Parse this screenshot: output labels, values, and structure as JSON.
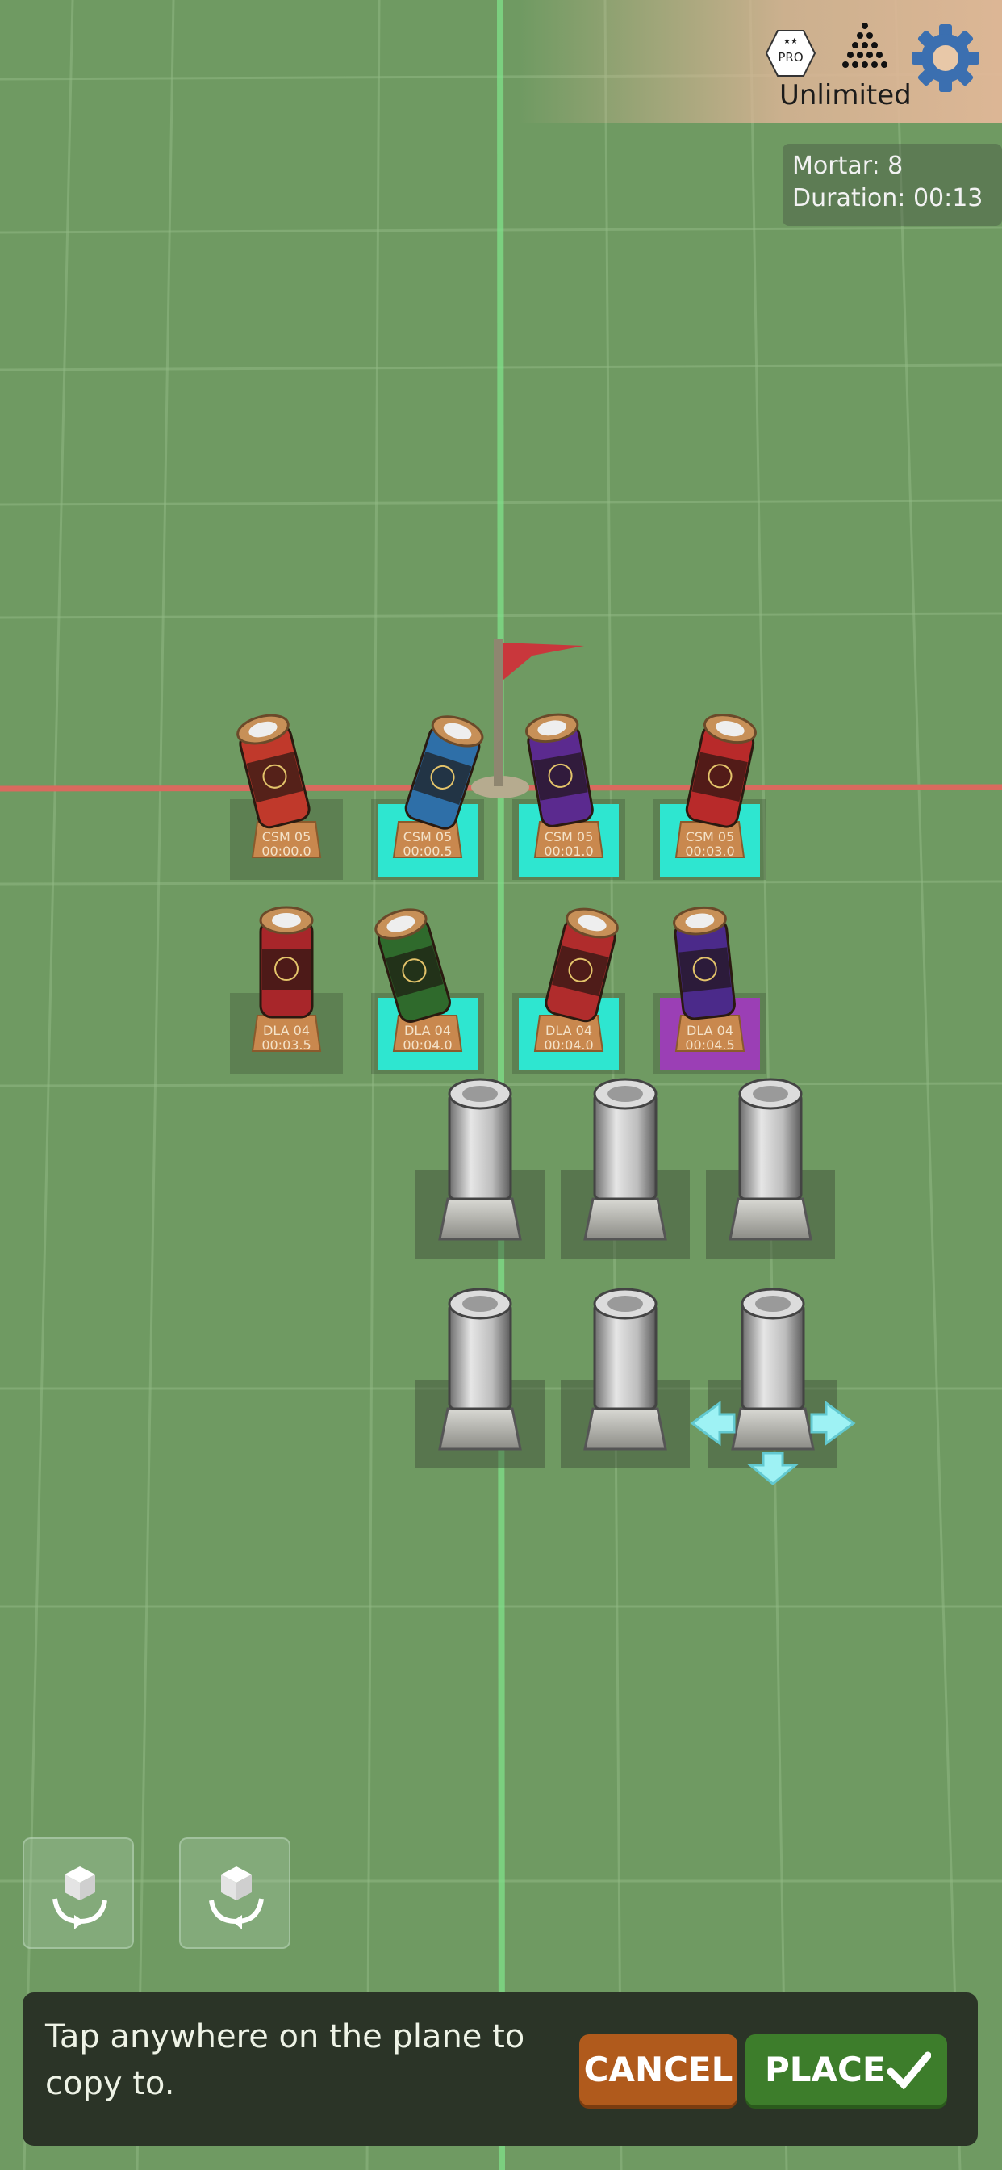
{
  "hud": {
    "pro_badge": "PRO",
    "mode_label": "Unlimited",
    "icons": [
      "pro-badge-icon",
      "fireworks-icon",
      "gear-icon"
    ]
  },
  "stats": {
    "mortar": "Mortar: 8",
    "duration": "Duration: 00:13"
  },
  "mortars_loaded": [
    {
      "code": "CSM 05",
      "time": "00:00.0",
      "color": "#c0392b",
      "selected": false
    },
    {
      "code": "CSM 05",
      "time": "00:00.5",
      "color": "#2e6fa8",
      "selected": true
    },
    {
      "code": "CSM 05",
      "time": "00:01.0",
      "color": "#5b2a8f",
      "selected": true
    },
    {
      "code": "CSM 05",
      "time": "00:03.0",
      "color": "#b82a2a",
      "selected": true
    },
    {
      "code": "DLA 04",
      "time": "00:03.5",
      "color": "#a8262a",
      "selected": false
    },
    {
      "code": "DLA 04",
      "time": "00:04.0",
      "color": "#2f6a2c",
      "selected": true
    },
    {
      "code": "DLA 04",
      "time": "00:04.0",
      "color": "#b02c2c",
      "selected": true
    },
    {
      "code": "DLA 04",
      "time": "00:04.5",
      "color": "#4b2a8a",
      "selected": "purple"
    }
  ],
  "colors": {
    "ground": "#6f9a62",
    "selection_cyan": "#2ee6d0",
    "selection_purple": "#9b3fb5",
    "cancel": "#b05a1c",
    "place": "#3d7d2b"
  },
  "bottom_bar": {
    "hint_line1": "Tap anywhere on the plane to",
    "hint_line2": "copy to.",
    "cancel_label": "CANCEL",
    "place_label": "PLACE"
  }
}
